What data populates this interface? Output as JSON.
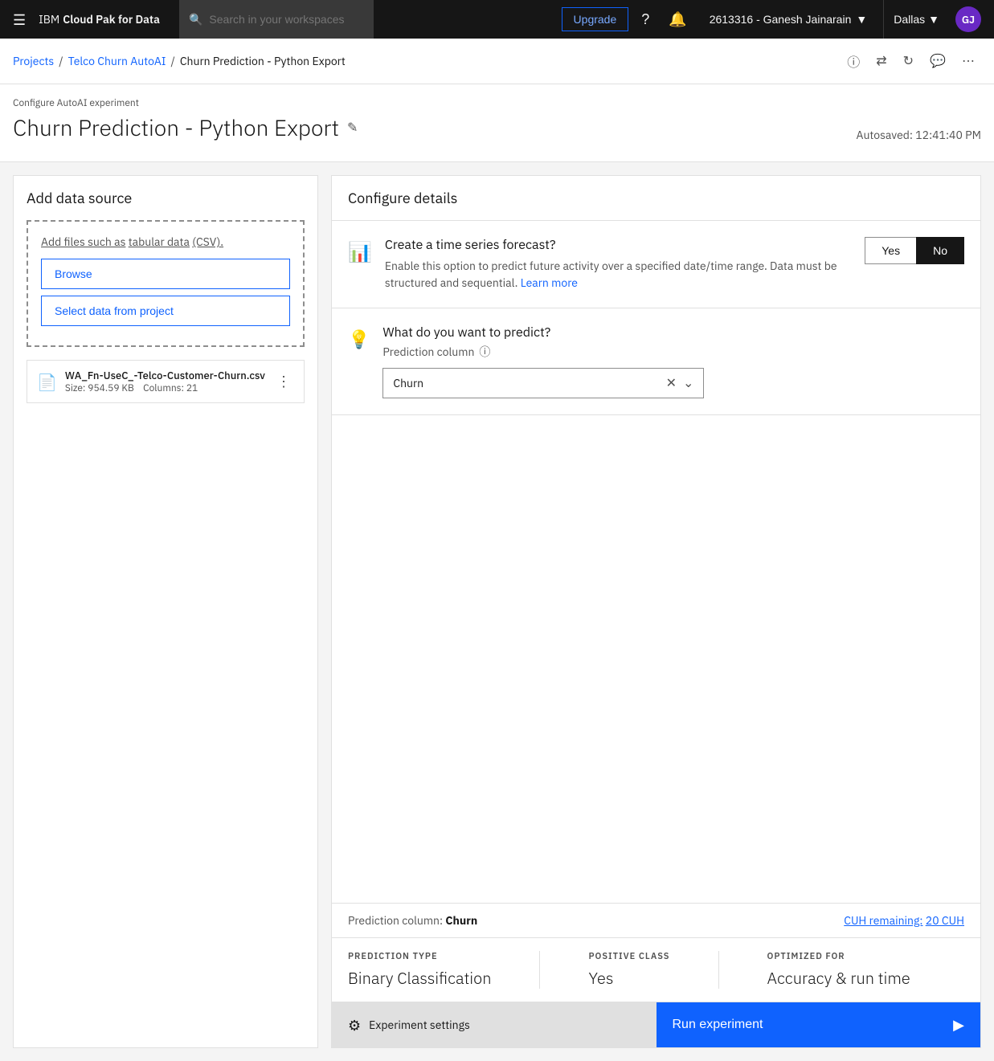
{
  "topnav": {
    "brand_ibm": "IBM",
    "brand_product": "Cloud Pak for Data",
    "search_placeholder": "Search in your workspaces",
    "upgrade_label": "Upgrade",
    "user_name": "2613316 - Ganesh Jainarain",
    "location": "Dallas",
    "avatar_initials": "GJ"
  },
  "breadcrumb": {
    "items": [
      {
        "label": "Projects",
        "link": true
      },
      {
        "label": "Telco Churn AutoAI",
        "link": true
      },
      {
        "label": "Churn Prediction - Python Export",
        "link": false
      }
    ]
  },
  "page_header": {
    "sub_label": "Configure AutoAI experiment",
    "title": "Churn Prediction - Python Export",
    "autosave": "Autosaved: 12:41:40 PM"
  },
  "left_panel": {
    "title": "Add data source",
    "drop_text_before": "Add files such as",
    "drop_text_link": "tabular data",
    "drop_text_after": "(CSV).",
    "browse_label": "Browse",
    "select_project_label": "Select data from project",
    "file": {
      "name": "WA_Fn-UseC_-Telco-Customer-Churn.csv",
      "size": "Size: 954.59 KB",
      "columns": "Columns: 21"
    }
  },
  "right_panel": {
    "header": "Configure details",
    "time_series": {
      "title": "Create a time series forecast?",
      "desc": "Enable this option to predict future activity over a specified date/time range. Data must be structured and sequential.",
      "learn_more": "Learn more",
      "yes_label": "Yes",
      "no_label": "No",
      "selected": "No"
    },
    "prediction": {
      "title": "What do you want to predict?",
      "column_label": "Prediction column",
      "value": "Churn"
    },
    "status_bar": {
      "pred_label": "Prediction column:",
      "pred_value": "Churn",
      "cuh_label": "CUH remaining:",
      "cuh_value": "20 CUH"
    },
    "pred_type": {
      "type_label": "PREDICTION TYPE",
      "type_value": "Binary Classification",
      "pos_class_label": "POSITIVE CLASS",
      "pos_class_value": "Yes",
      "optimized_label": "OPTIMIZED FOR",
      "optimized_value": "Accuracy & run time"
    },
    "footer": {
      "settings_label": "Experiment settings",
      "run_label": "Run experiment"
    }
  }
}
